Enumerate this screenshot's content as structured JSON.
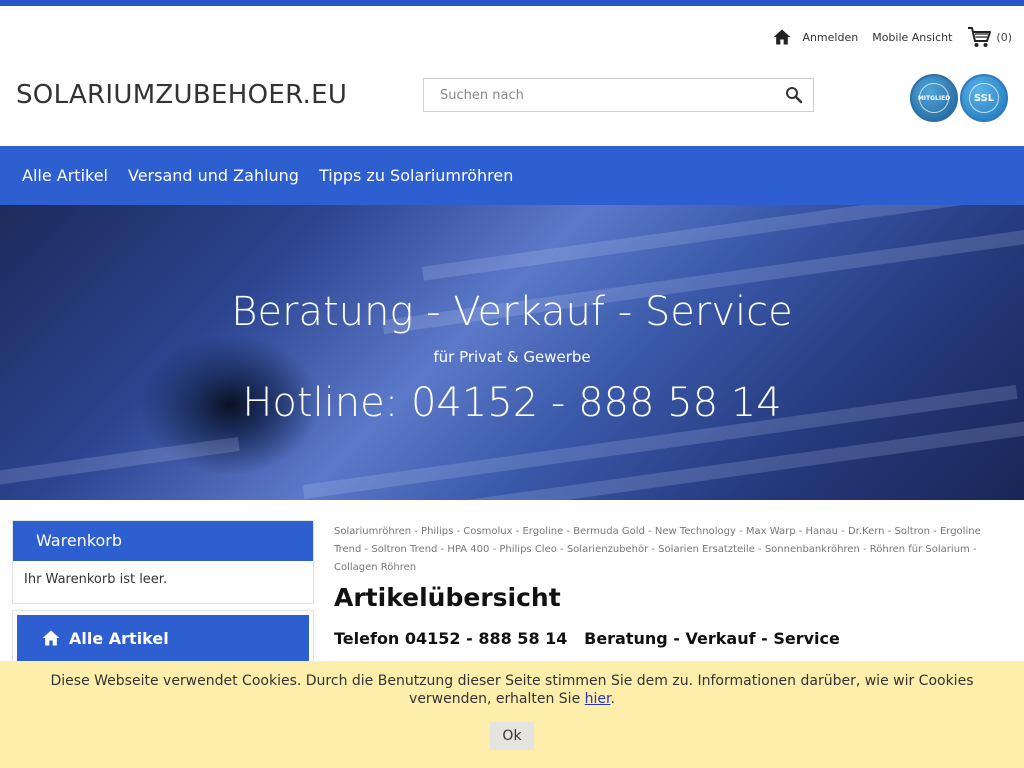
{
  "header": {
    "logo": "SOLARIUMZUBEHOER.EU",
    "links": {
      "login": "Anmelden",
      "mobile": "Mobile Ansicht",
      "cart_count": "(0)"
    },
    "search_placeholder": "Suchen nach",
    "badges": {
      "member": "MITGLIED",
      "ssl": "SSL"
    }
  },
  "nav": {
    "items": [
      "Alle Artikel",
      "Versand und Zahlung",
      "Tipps zu Solariumröhren"
    ]
  },
  "hero": {
    "title": "Beratung - Verkauf - Service",
    "subtitle": "für Privat & Gewerbe",
    "hotline": "Hotline: 04152 - 888 58 14"
  },
  "sidebar": {
    "cart_title": "Warenkorb",
    "cart_empty": "Ihr Warenkorb ist leer.",
    "category_button": "Alle Artikel"
  },
  "main": {
    "tags": [
      "Solariumröhren",
      "Philips",
      "Cosmolux",
      "Ergoline",
      "Bermuda Gold",
      "New Technology",
      "Max Warp",
      "Hanau",
      "Dr.Kern",
      "Soltron",
      "Ergoline Trend",
      "Soltron Trend",
      "HPA 400",
      "Philips Cleo",
      "Solarienzubehör",
      "Solarien Ersatzteile",
      "Sonnenbankröhren",
      "Röhren für Solarium",
      "Collagen Röhren"
    ],
    "title": "Artikelübersicht",
    "phone_line": "Telefon 04152 - 888 58 14   Beratung - Verkauf - Service"
  },
  "cookie": {
    "text": "Diese Webseite verwendet Cookies. Durch die Benutzung dieser Seite stimmen Sie dem zu. Informationen darüber, wie wir Cookies verwenden, erhalten Sie ",
    "link": "hier",
    "after": ".",
    "ok": "Ok"
  },
  "colors": {
    "accent": "#2e5fd1",
    "cookie_bg": "#fdeeab"
  }
}
